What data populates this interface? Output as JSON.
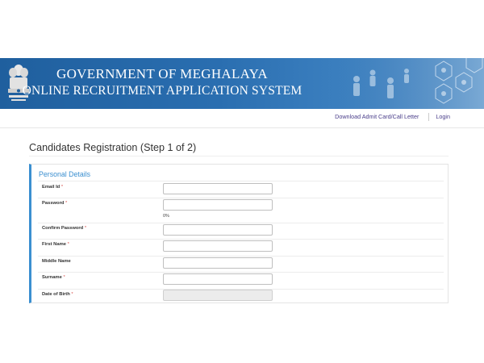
{
  "banner": {
    "line1": "GOVERNMENT OF MEGHALAYA",
    "line2": "ONLINE RECRUITMENT APPLICATION SYSTEM",
    "emblem_icon": "state-emblem-icon"
  },
  "nav": {
    "admit_card": "Download Admit Card/Call Letter",
    "login": "Login"
  },
  "page": {
    "title": "Candidates Registration (Step 1 of 2)"
  },
  "panel": {
    "title": "Personal Details",
    "required_marker": "*",
    "fields": {
      "email": {
        "label": "Email Id",
        "value": ""
      },
      "password": {
        "label": "Password",
        "value": "",
        "strength": "0%"
      },
      "confirm_password": {
        "label": "Confirm Password",
        "value": ""
      },
      "first_name": {
        "label": "First Name",
        "value": ""
      },
      "middle_name": {
        "label": "Middle Name",
        "value": ""
      },
      "surname": {
        "label": "Surname",
        "value": ""
      },
      "dob": {
        "label": "Date of Birth",
        "value": ""
      }
    }
  },
  "colors": {
    "banner_blue": "#2a6eb0",
    "accent": "#3b8fd0",
    "link": "#4a3e8a",
    "required": "#d9534f"
  }
}
